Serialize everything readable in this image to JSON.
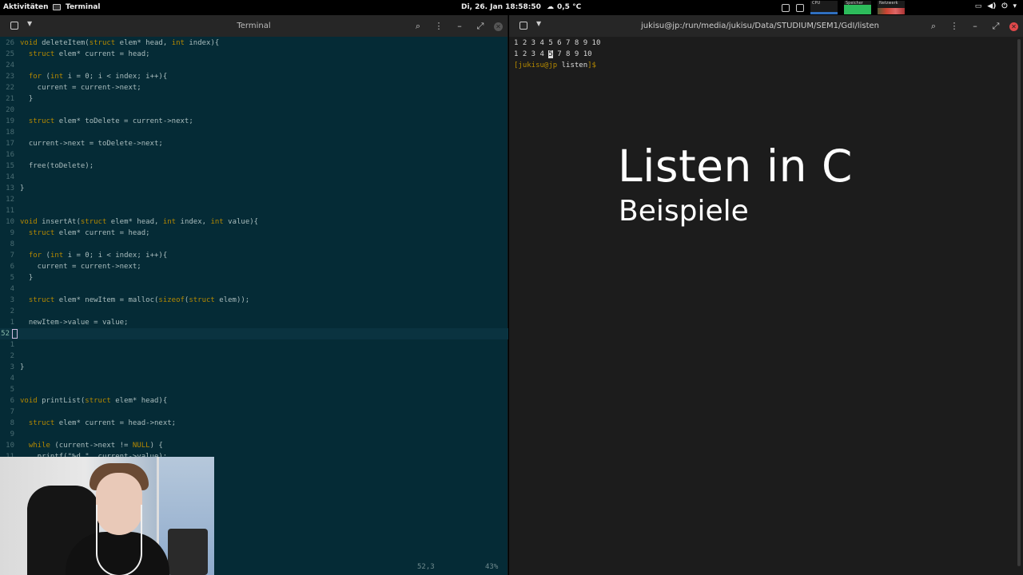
{
  "topbar": {
    "activities": "Aktivitäten",
    "app_name": "Terminal",
    "clock": "Di, 26. Jan  18:58:50",
    "temperature": "0,5 °C",
    "monitors": [
      {
        "label": "CPU",
        "color": "#2f6fbf"
      },
      {
        "label": "Speicher",
        "color": "#2dbb5b"
      },
      {
        "label": "Netzwerk",
        "color": "#cc4433"
      }
    ]
  },
  "left_terminal": {
    "title": "Terminal",
    "code_lines": [
      {
        "ln": "26",
        "text": "void deleteItem(struct elem* head, int index){"
      },
      {
        "ln": "25",
        "text": "  struct elem* current = head;"
      },
      {
        "ln": "24",
        "text": ""
      },
      {
        "ln": "23",
        "text": "  for (int i = 0; i < index; i++){"
      },
      {
        "ln": "22",
        "text": "    current = current->next;"
      },
      {
        "ln": "21",
        "text": "  }"
      },
      {
        "ln": "20",
        "text": ""
      },
      {
        "ln": "19",
        "text": "  struct elem* toDelete = current->next;"
      },
      {
        "ln": "18",
        "text": ""
      },
      {
        "ln": "17",
        "text": "  current->next = toDelete->next;"
      },
      {
        "ln": "16",
        "text": ""
      },
      {
        "ln": "15",
        "text": "  free(toDelete);"
      },
      {
        "ln": "14",
        "text": ""
      },
      {
        "ln": "13",
        "text": "}"
      },
      {
        "ln": "12",
        "text": ""
      },
      {
        "ln": "11",
        "text": ""
      },
      {
        "ln": "10",
        "text": "void insertAt(struct elem* head, int index, int value){"
      },
      {
        "ln": "9",
        "text": "  struct elem* current = head;"
      },
      {
        "ln": "8",
        "text": ""
      },
      {
        "ln": "7",
        "text": "  for (int i = 0; i < index; i++){"
      },
      {
        "ln": "6",
        "text": "    current = current->next;"
      },
      {
        "ln": "5",
        "text": "  }"
      },
      {
        "ln": "4",
        "text": ""
      },
      {
        "ln": "3",
        "text": "  struct elem* newItem = malloc(sizeof(struct elem));"
      },
      {
        "ln": "2",
        "text": ""
      },
      {
        "ln": "1",
        "text": "  newItem->value = value;"
      },
      {
        "ln": "52",
        "text": "",
        "current": true
      },
      {
        "ln": "1",
        "text": ""
      },
      {
        "ln": "2",
        "text": ""
      },
      {
        "ln": "3",
        "text": "}"
      },
      {
        "ln": "4",
        "text": ""
      },
      {
        "ln": "5",
        "text": ""
      },
      {
        "ln": "6",
        "text": "void printList(struct elem* head){"
      },
      {
        "ln": "7",
        "text": ""
      },
      {
        "ln": "8",
        "text": "  struct elem* current = head->next;"
      },
      {
        "ln": "9",
        "text": ""
      },
      {
        "ln": "10",
        "text": "  while (current->next != NULL) {"
      },
      {
        "ln": "11",
        "text": "    printf(\"%d \", current->value);"
      }
    ],
    "status_position": "52,3",
    "status_percent": "43%"
  },
  "right_terminal": {
    "title": "jukisu@jp:/run/media/jukisu/Data/STUDIUM/SEM1/GdI/listen",
    "output_line_1": "1 2 3 4 5 6 7 8 9 10",
    "output_line_2_before": "1 2 3 4 ",
    "output_line_2_highlight": "5",
    "output_line_2_after": " 7 8 9 10",
    "prompt_user": "[jukisu@jp",
    "prompt_dir": "listen",
    "prompt_symbol": "]$"
  },
  "overlay": {
    "title": "Listen in C",
    "subtitle": "Beispiele"
  }
}
